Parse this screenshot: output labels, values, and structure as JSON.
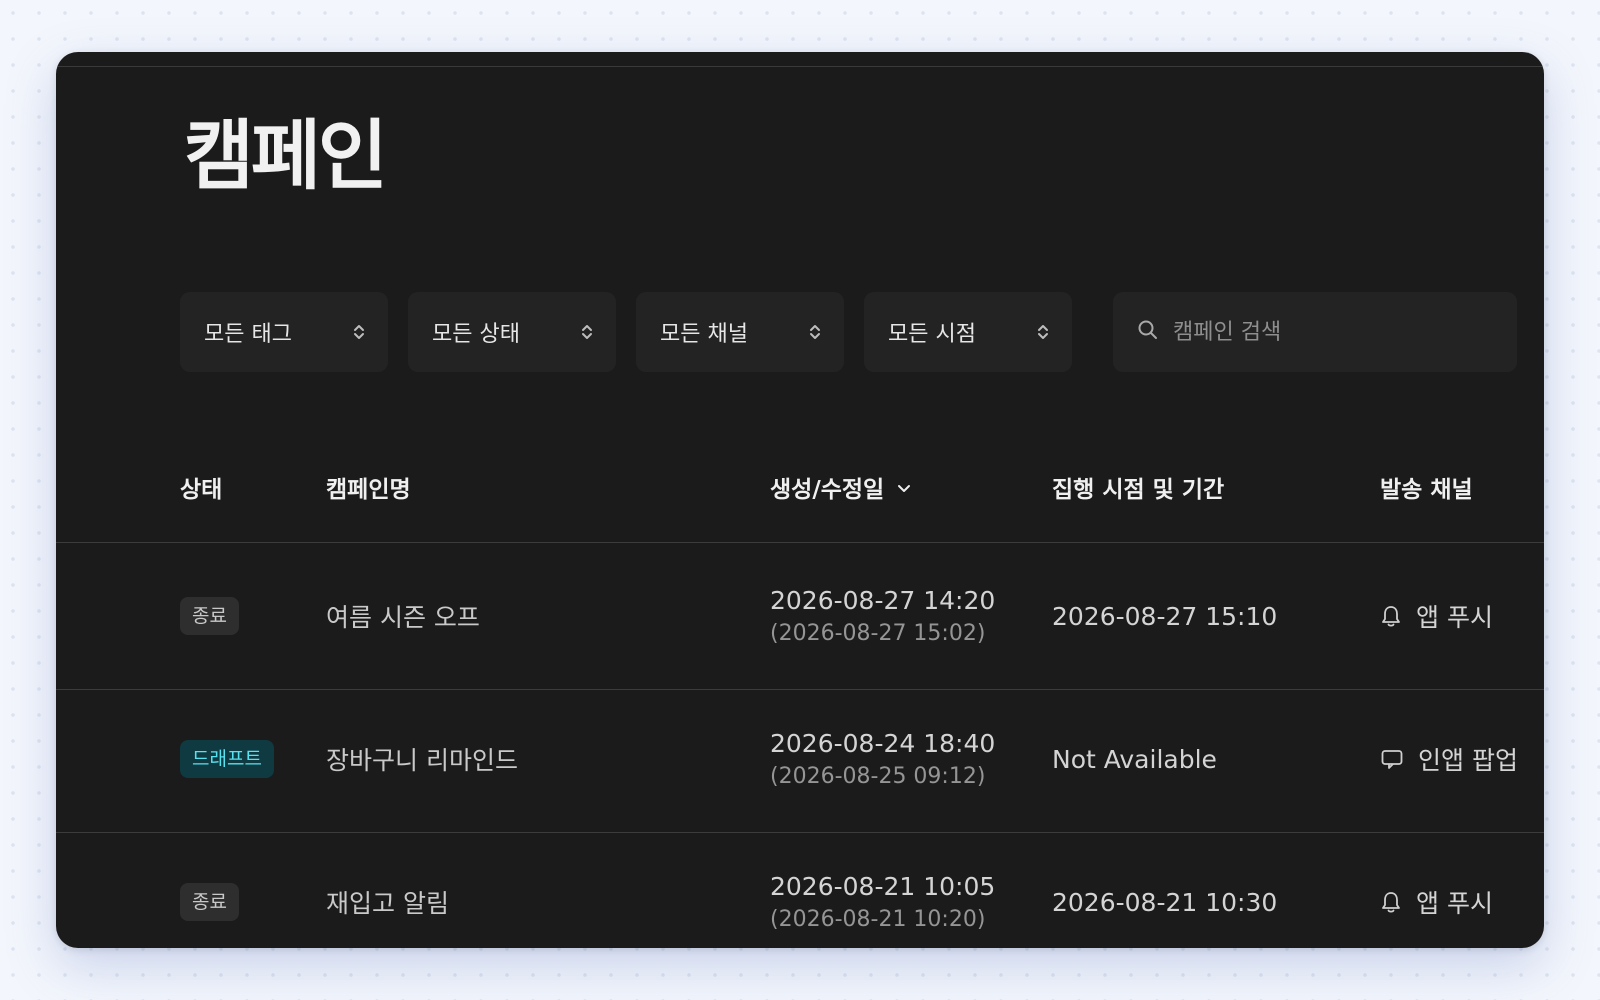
{
  "page": {
    "title": "캠페인"
  },
  "filters": [
    {
      "label": "모든 태그",
      "icon": "sort-icon"
    },
    {
      "label": "모든 상태",
      "icon": "sort-icon"
    },
    {
      "label": "모든 채널",
      "icon": "sort-icon"
    },
    {
      "label": "모든 시점",
      "icon": "sort-icon"
    }
  ],
  "search": {
    "placeholder": "캠페인 검색",
    "value": "",
    "icon": "search-icon"
  },
  "table": {
    "columns": {
      "status": "상태",
      "name": "캠페인명",
      "date": "생성/수정일",
      "execution": "집행 시점 및 기간",
      "channel": "발송 채널"
    },
    "sorted_column_icon": "chevron-down-icon",
    "rows": [
      {
        "status": "종료",
        "name": "여름 시즌 오프",
        "created": "2026-08-27 14:20",
        "modified": "(2026-08-27 15:02)",
        "execution": "2026-08-27 15:10",
        "channel": "앱 푸시",
        "channel_icon": "bell-icon"
      },
      {
        "status": "드래프트",
        "name": "장바구니 리마인드",
        "created": "2026-08-24 18:40",
        "modified": "(2026-08-25 09:12)",
        "execution": "Not Available",
        "channel": "인앱 팝업",
        "channel_icon": "message-icon"
      },
      {
        "status": "종료",
        "name": "재입고 알림",
        "created": "2026-08-21 10:05",
        "modified": "(2026-08-21 10:20)",
        "execution": "2026-08-21 10:30",
        "channel": "앱 푸시",
        "channel_icon": "bell-icon"
      }
    ]
  },
  "colors": {
    "background": "#f3f6fc",
    "panel": "#1b1b1b",
    "control": "#232323",
    "draft_badge_bg": "#0f3a41",
    "draft_badge_text": "#58e1ee",
    "ended_badge_bg": "#2e2e2e",
    "ended_badge_text": "#c8c8c8"
  }
}
